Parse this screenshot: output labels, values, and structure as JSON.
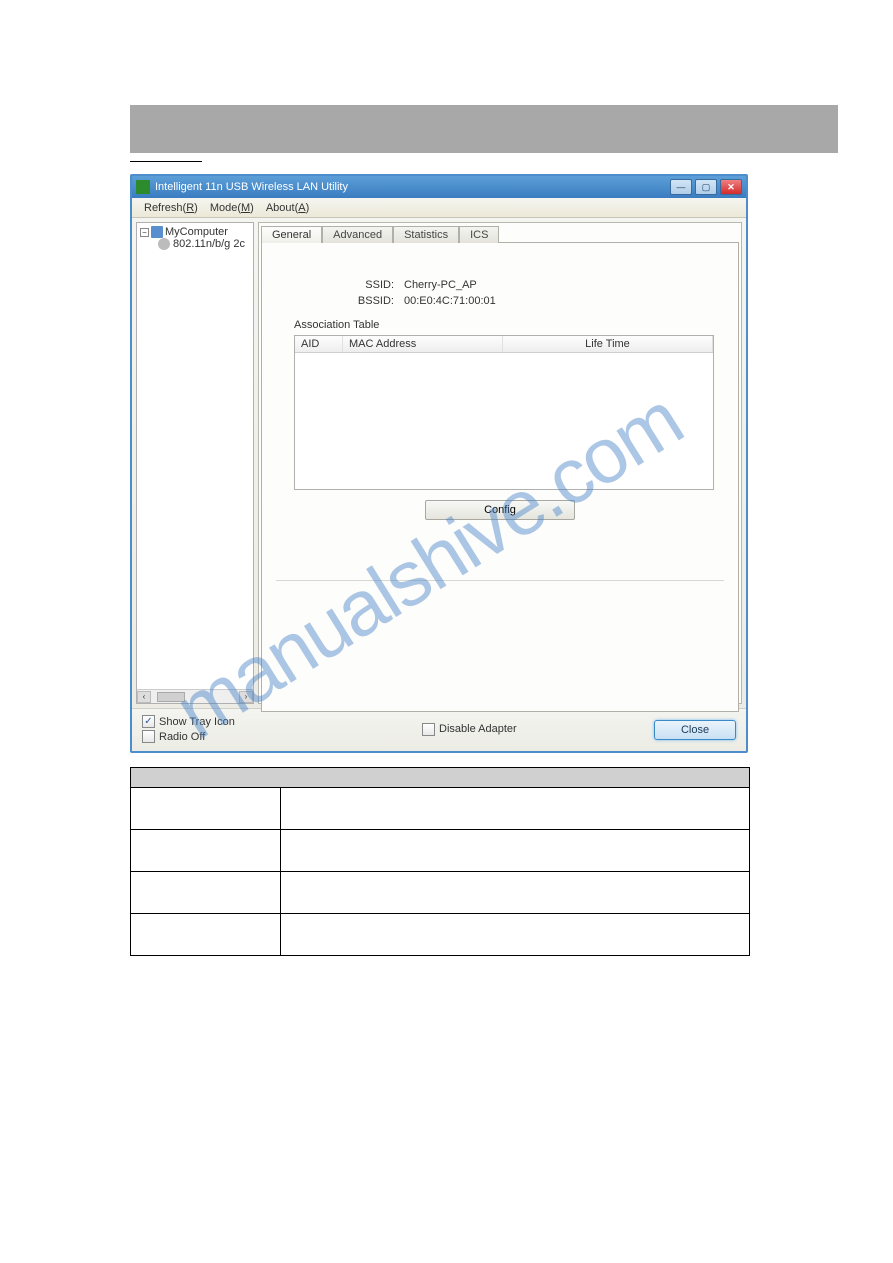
{
  "window": {
    "title": "Intelligent 11n USB Wireless LAN Utility"
  },
  "menubar": {
    "refresh": "Refresh(R)",
    "mode": "Mode(M)",
    "about": "About(A)"
  },
  "tree": {
    "root": "MyComputer",
    "child": "802.11n/b/g 2c",
    "toggle": "−"
  },
  "tabs": {
    "general": "General",
    "advanced": "Advanced",
    "statistics": "Statistics",
    "ics": "ICS",
    "active": "general"
  },
  "general": {
    "ssid_label": "SSID:",
    "ssid_value": "Cherry-PC_AP",
    "bssid_label": "BSSID:",
    "bssid_value": "00:E0:4C:71:00:01",
    "assoc_label": "Association Table",
    "columns": {
      "aid": "AID",
      "mac": "MAC Address",
      "life": "Life Time"
    },
    "rows": [],
    "config_btn": "Config"
  },
  "footer": {
    "show_tray": "Show Tray Icon",
    "show_tray_checked": true,
    "radio_off": "Radio Off",
    "radio_off_checked": false,
    "disable_adapter": "Disable Adapter",
    "disable_adapter_checked": false,
    "close": "Close"
  },
  "watermark": "manualshive.com"
}
